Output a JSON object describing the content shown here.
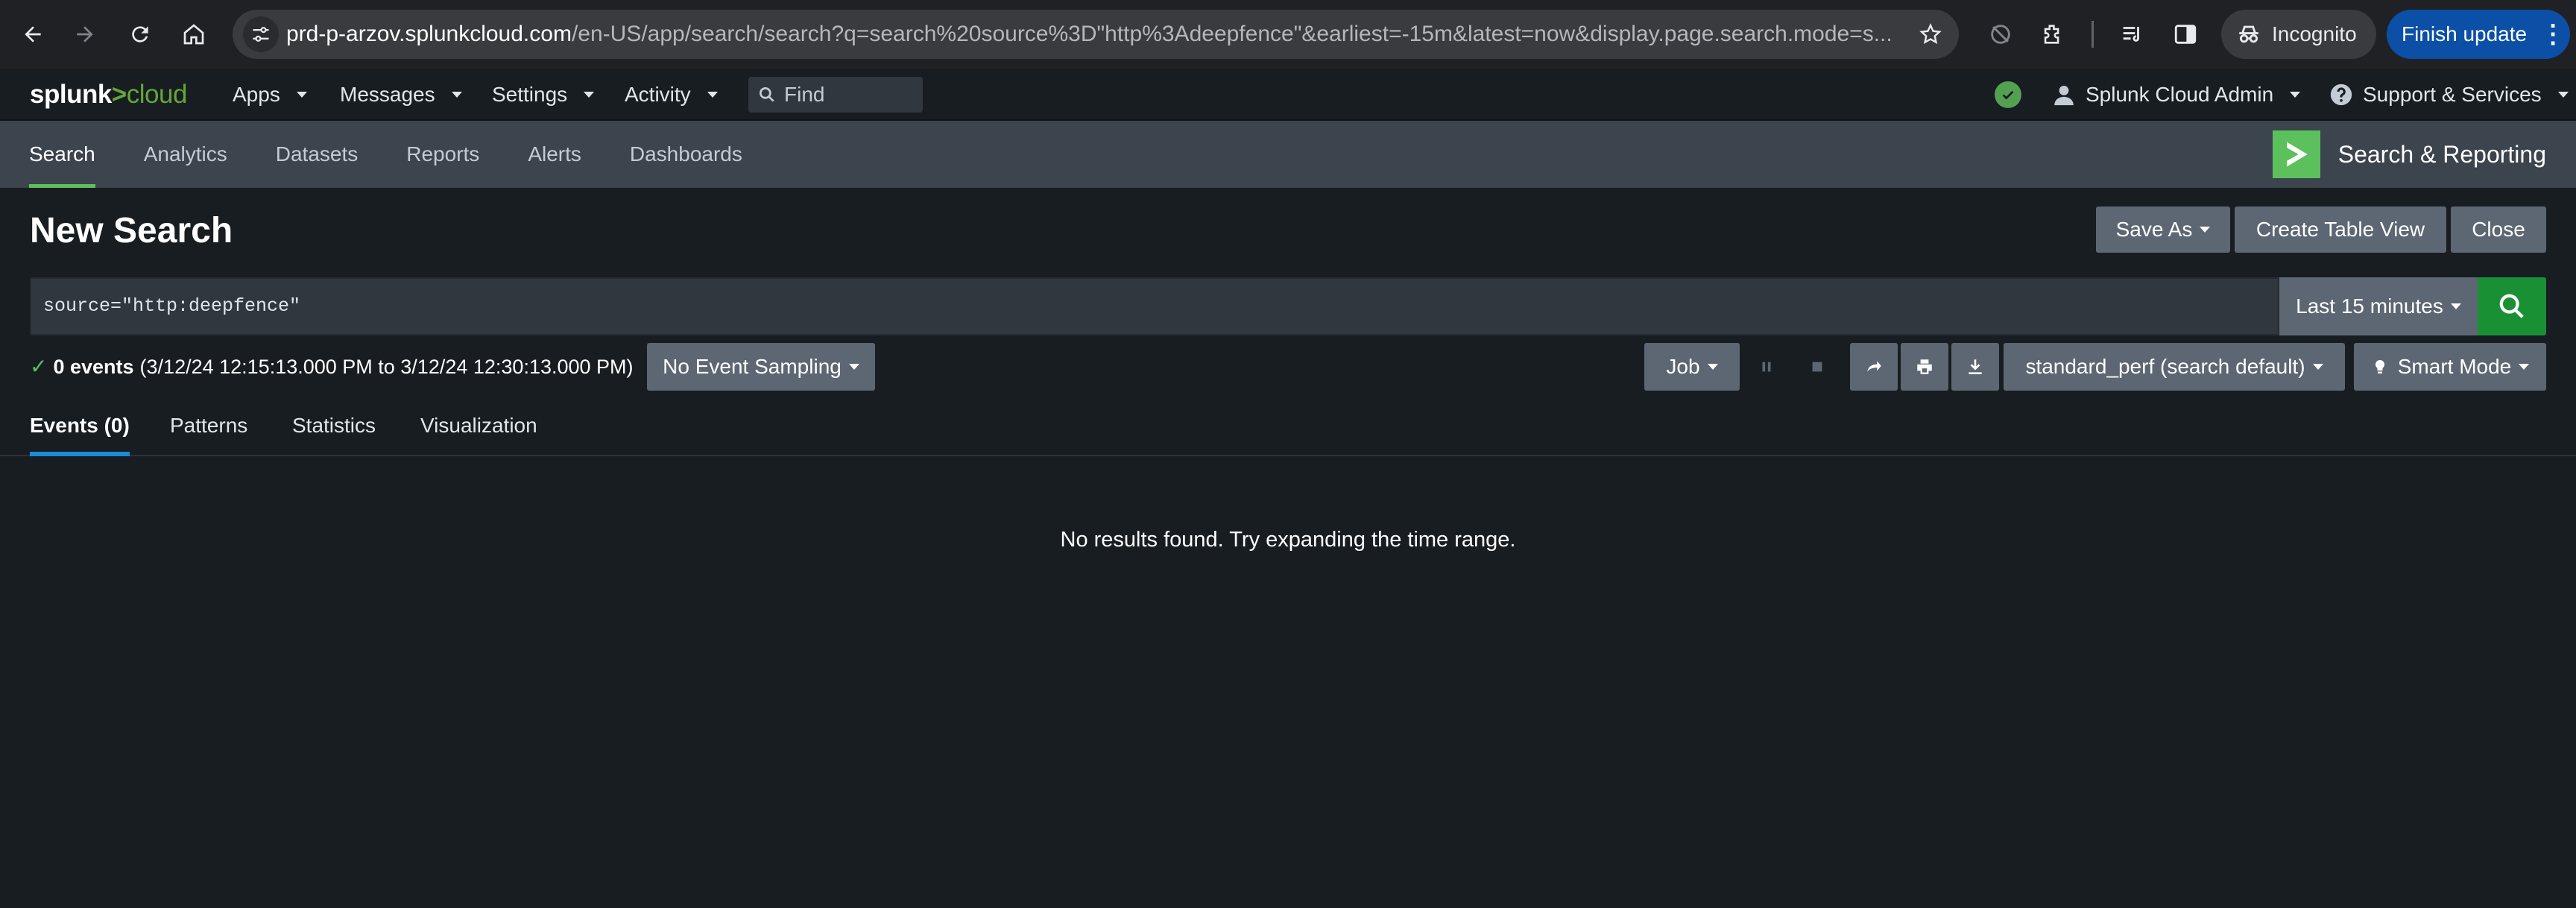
{
  "browser": {
    "url_host": "prd-p-arzov.splunkcloud.com",
    "url_rest": "/en-US/app/search/search?q=search%20source%3D\"http%3Adeepfence\"&earliest=-15m&latest=now&display.page.search.mode=s...",
    "incognito_label": "Incognito",
    "finish_update_label": "Finish update"
  },
  "splunkbar": {
    "logo_splunk": "splunk",
    "logo_gt": ">",
    "logo_cloud": "cloud",
    "menus": [
      "Apps",
      "Messages",
      "Settings",
      "Activity"
    ],
    "find_placeholder": "Find",
    "user_label": "Splunk Cloud Admin",
    "support_label": "Support & Services"
  },
  "appbar": {
    "nav": [
      "Search",
      "Analytics",
      "Datasets",
      "Reports",
      "Alerts",
      "Dashboards"
    ],
    "active_nav": "Search",
    "app_title": "Search & Reporting"
  },
  "search": {
    "page_title": "New Search",
    "buttons": {
      "save_as": "Save As",
      "create_table_view": "Create Table View",
      "close": "Close"
    },
    "query": "source=\"http:deepfence\"",
    "time_range": "Last 15 minutes"
  },
  "job": {
    "event_count": "0 events",
    "time_window": "(3/12/24 12:15:13.000 PM to 3/12/24 12:30:13.000 PM)",
    "sampling": "No Event Sampling",
    "job_menu": "Job",
    "workload": "standard_perf (search default)",
    "mode": "Smart Mode"
  },
  "tabs": {
    "events": "Events (0)",
    "patterns": "Patterns",
    "statistics": "Statistics",
    "visualization": "Visualization"
  },
  "results": {
    "empty_message": "No results found. Try expanding the time range."
  },
  "colors": {
    "accent_green": "#5cc05c",
    "search_button": "#1a9035",
    "tab_underline": "#1a8cd8",
    "button_gray": "#5c6773",
    "app_bar": "#3c444d",
    "background": "#171d21"
  }
}
